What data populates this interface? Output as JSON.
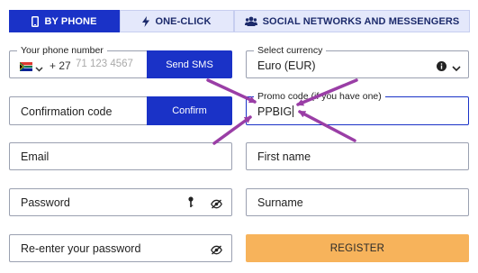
{
  "tabs": [
    {
      "label": "BY PHONE",
      "icon": "phone-icon",
      "active": true
    },
    {
      "label": "ONE-CLICK",
      "icon": "lightning-icon",
      "active": false
    },
    {
      "label": "SOCIAL NETWORKS AND MESSENGERS",
      "icon": "people-icon",
      "active": false
    }
  ],
  "phone": {
    "label": "Your phone number",
    "country_flag": "flag-south-africa-icon",
    "code": "+ 27",
    "placeholder": "71 123 4567",
    "button": "Send SMS"
  },
  "currency": {
    "label": "Select currency",
    "value": "Euro (EUR)"
  },
  "confirmation": {
    "placeholder": "Confirmation code",
    "button": "Confirm"
  },
  "promo": {
    "label": "Promo code (if you have one)",
    "value": "PPBIG"
  },
  "email": {
    "placeholder": "Email"
  },
  "first_name": {
    "placeholder": "First name"
  },
  "password": {
    "placeholder": "Password"
  },
  "surname": {
    "placeholder": "Surname"
  },
  "repeat_password": {
    "placeholder": "Re-enter your password"
  },
  "register_button": "REGISTER",
  "colors": {
    "primary": "#1a32c7",
    "tab_inactive": "#e4e8fb",
    "register": "#f7b35b",
    "annotation_arrow": "#9a3ea6"
  }
}
